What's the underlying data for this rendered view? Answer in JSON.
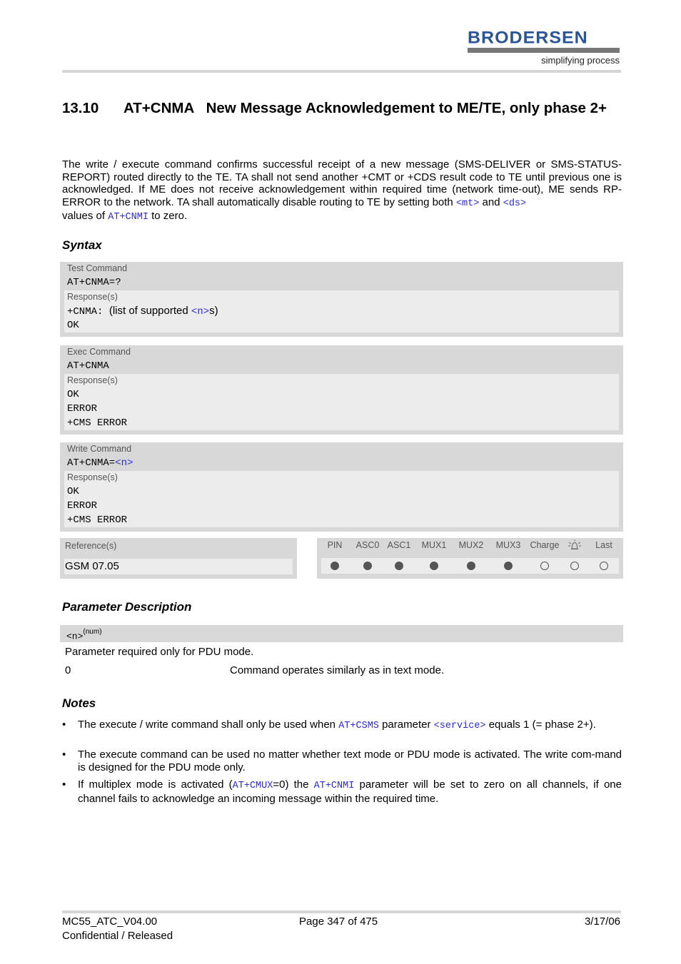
{
  "header": {
    "logo_word": "BRODERSEN",
    "logo_tagline": "simplifying process"
  },
  "section": {
    "number": "13.10",
    "title": "AT+CNMA   New Message Acknowledgement to ME/TE, only phase 2+"
  },
  "intro": {
    "text_a": "The write / execute command confirms successful receipt of a new message (SMS-DELIVER or SMS-STATUS-REPORT) routed directly to the TE. TA shall not send another +CMT or +CDS result code to TE until previous one is acknowledged. If ME does not receive acknowledgement within required time (network time-out), ME sends RP-ERROR to the network. TA shall automatically disable routing to TE by setting both ",
    "link_mt": "<mt>",
    "text_b": " and ",
    "link_ds": "<ds>",
    "text_c": " values of ",
    "link_cnmi": "AT+CNMI",
    "text_d": " to zero."
  },
  "syntax": {
    "heading": "Syntax",
    "test": {
      "label": "Test Command",
      "command": "AT+CNMA=?",
      "response_label": "Response(s)",
      "resp_prefix": "+CNMA:",
      "resp_text_a": "(list of supported ",
      "resp_link": "<n>",
      "resp_text_b": "s)",
      "resp_ok": "OK"
    },
    "exec": {
      "label": "Exec Command",
      "command": "AT+CNMA",
      "response_label": "Response(s)",
      "responses": [
        "OK",
        "ERROR",
        "+CMS ERROR"
      ]
    },
    "write": {
      "label": "Write Command",
      "command_prefix": "AT+CNMA=",
      "command_link": "<n>",
      "response_label": "Response(s)",
      "responses": [
        "OK",
        "ERROR",
        "+CMS ERROR"
      ]
    },
    "reference": {
      "label": "Reference(s)",
      "value": "GSM 07.05"
    },
    "availability": {
      "columns": [
        "PIN",
        "ASC0",
        "ASC1",
        "MUX1",
        "MUX2",
        "MUX3",
        "Charge",
        "alarm-icon",
        "Last"
      ],
      "values": [
        true,
        true,
        true,
        true,
        true,
        true,
        false,
        false,
        false
      ]
    }
  },
  "parameters": {
    "heading": "Parameter Description",
    "name": "<n>",
    "type": "(num)",
    "description": "Parameter required only for PDU mode.",
    "values": [
      {
        "value": "0",
        "meaning": "Command operates similarly as in text mode."
      }
    ]
  },
  "notes": {
    "heading": "Notes",
    "bullet": "•",
    "n1": {
      "a": "The execute / write command shall only be used when ",
      "link1": "AT+CSMS",
      "b": " parameter ",
      "link2": "<service>",
      "c": " equals 1 (= phase 2+)."
    },
    "n2": {
      "a": "The execute command can be used no matter whether text mode or PDU mode is activated. The write com-mand is designed for the PDU mode only."
    },
    "n3": {
      "a": "If multiplex mode is activated (",
      "link1": "AT+CMUX",
      "b": "=0) the ",
      "link2": "AT+CNMI",
      "c": " parameter will be set to zero on all channels, if one channel fails to acknowledge an incoming message within the required time."
    }
  },
  "footer": {
    "doc_id": "MC55_ATC_V04.00",
    "status": "Confidential / Released",
    "page": "Page 347 of 475",
    "date": "3/17/06"
  }
}
